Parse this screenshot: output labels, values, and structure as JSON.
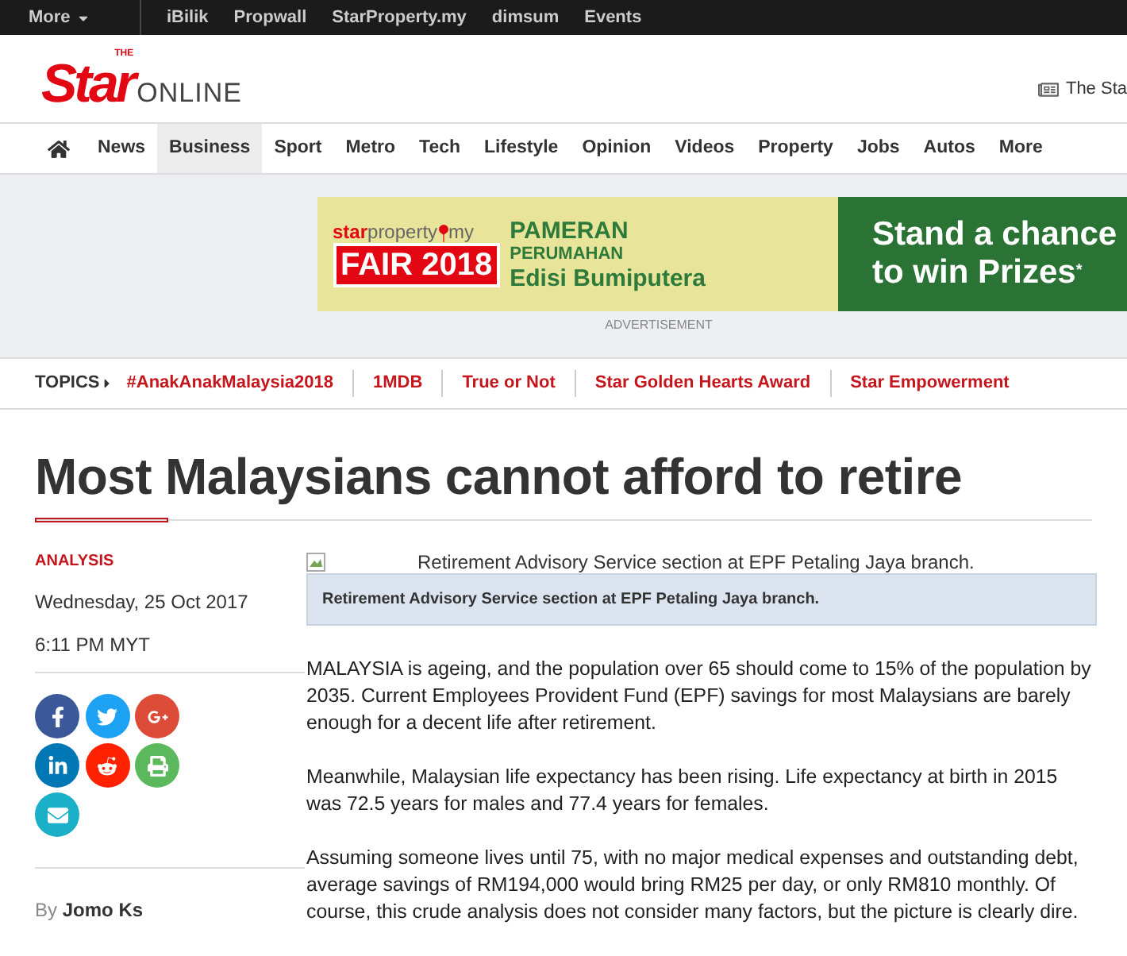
{
  "top_bar": {
    "more": "More",
    "links": [
      "iBilik",
      "Propwall",
      "StarProperty.my",
      "dimsum",
      "Events"
    ]
  },
  "logo": {
    "the": "THE",
    "star": "Star",
    "online": "ONLINE"
  },
  "edition_link": "The Sta",
  "nav": [
    {
      "label": "News",
      "selected": false
    },
    {
      "label": "Business",
      "selected": true
    },
    {
      "label": "Sport",
      "selected": false
    },
    {
      "label": "Metro",
      "selected": false
    },
    {
      "label": "Tech",
      "selected": false
    },
    {
      "label": "Lifestyle",
      "selected": false
    },
    {
      "label": "Opinion",
      "selected": false
    },
    {
      "label": "Videos",
      "selected": false
    },
    {
      "label": "Property",
      "selected": false
    },
    {
      "label": "Jobs",
      "selected": false
    },
    {
      "label": "Autos",
      "selected": false
    },
    {
      "label": "More",
      "selected": false
    }
  ],
  "ad": {
    "brand_red": "star",
    "brand_gray": "property",
    "brand_suffix": "my",
    "fair": "FAIR 2018",
    "expo": [
      "PAMERAN",
      "PERUMAHAN",
      "Edisi Bumiputera"
    ],
    "promo": [
      "Stand a chance",
      "to win Prizes"
    ],
    "promo_mark": "*",
    "label": "ADVERTISEMENT"
  },
  "topics": {
    "label": "TOPICS",
    "items": [
      "#AnakAnakMalaysia2018",
      "1MDB",
      "True or Not",
      "Star Golden Hearts Award",
      "Star Empowerment"
    ]
  },
  "article": {
    "headline": "Most Malaysians cannot afford to retire",
    "category": "ANALYSIS",
    "date": "Wednesday, 25 Oct 2017",
    "time": "6:11 PM MYT",
    "share": [
      {
        "kind": "facebook",
        "color": "#3b5998"
      },
      {
        "kind": "twitter",
        "color": "#1da1f2"
      },
      {
        "kind": "google",
        "color": "#dd4b39"
      },
      {
        "kind": "linkedin",
        "color": "#0077b5"
      },
      {
        "kind": "reddit",
        "color": "#ff2200"
      },
      {
        "kind": "print",
        "color": "#5cb85c"
      },
      {
        "kind": "email",
        "color": "#1bb0c8"
      }
    ],
    "byline_prefix": "By",
    "author": "Jomo Ks",
    "image_alt": "Retirement Advisory Service section at EPF Petaling Jaya branch.",
    "caption": "Retirement Advisory Service section at EPF Petaling Jaya branch.",
    "paragraphs": [
      "MALAYSIA is ageing, and the population over 65 should come to 15% of the population by 2035. Current Employees Provident Fund (EPF) savings for most Malaysians are barely enough for a decent life after retirement.",
      "Meanwhile, Malaysian life expectancy has been rising. Life expectancy at birth in 2015 was 72.5 years for males and 77.4 years for females.",
      "Assuming someone lives until 75, with no major medical expenses and outstanding debt, average savings of RM194,000 would bring RM25 per day, or only RM810 monthly. Of course, this crude analysis does not consider many factors, but the picture is clearly dire."
    ]
  }
}
